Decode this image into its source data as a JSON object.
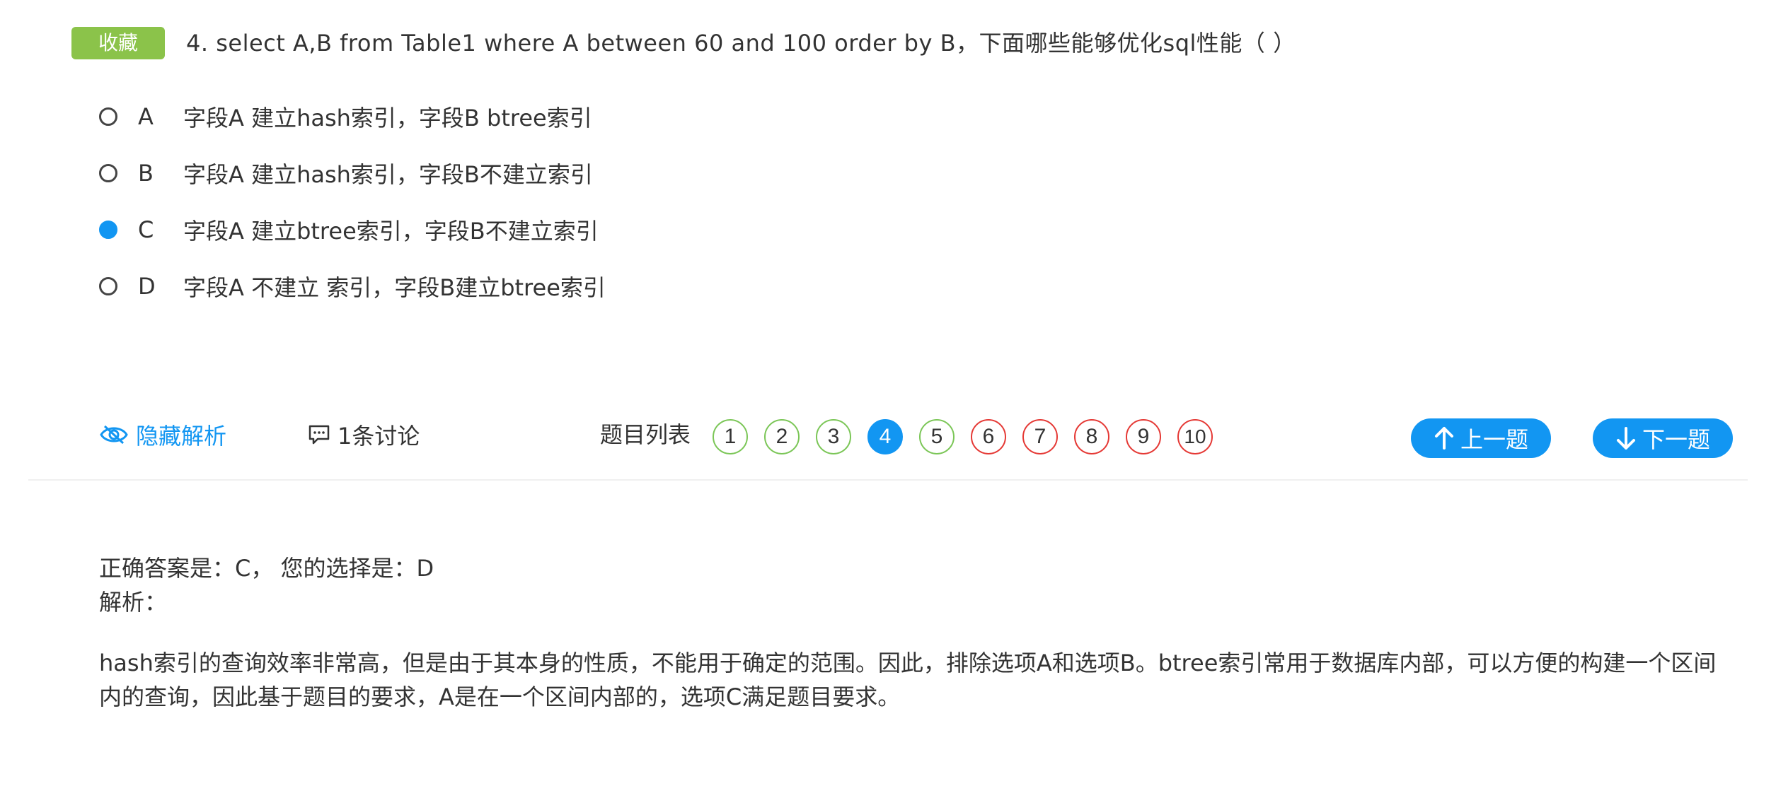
{
  "question": {
    "favorite_label": "收藏",
    "text": "4. select A,B from Table1 where A between 60 and 100 order by B，下面哪些能够优化sql性能（ ）"
  },
  "options": [
    {
      "letter": "A",
      "text": "字段A 建立hash索引，字段B btree索引",
      "selected": false
    },
    {
      "letter": "B",
      "text": "字段A 建立hash索引，字段B不建立索引",
      "selected": false
    },
    {
      "letter": "C",
      "text": "字段A 建立btree索引，字段B不建立索引",
      "selected": true
    },
    {
      "letter": "D",
      "text": "字段A 不建立 索引，字段B建立btree索引",
      "selected": false
    }
  ],
  "toolbar": {
    "hide_analysis_label": "隐藏解析",
    "discussion_label": "1条讨论",
    "question_list_label": "题目列表",
    "question_numbers": [
      {
        "num": "1",
        "status": "correct"
      },
      {
        "num": "2",
        "status": "correct"
      },
      {
        "num": "3",
        "status": "correct"
      },
      {
        "num": "4",
        "status": "current"
      },
      {
        "num": "5",
        "status": "correct"
      },
      {
        "num": "6",
        "status": "wrong"
      },
      {
        "num": "7",
        "status": "wrong"
      },
      {
        "num": "8",
        "status": "wrong"
      },
      {
        "num": "9",
        "status": "wrong"
      },
      {
        "num": "10",
        "status": "wrong"
      }
    ],
    "prev_label": "上一题",
    "next_label": "下一题"
  },
  "answer": {
    "summary": "正确答案是：C，  您的选择是：D",
    "analysis_label": "解析：",
    "analysis_text": "hash索引的查询效率非常高，但是由于其本身的性质，不能用于确定的范围。因此，排除选项A和选项B。btree索引常用于数据库内部，可以方便的构建一个区间内的查询，因此基于题目的要求，A是在一个区间内部的，选项C满足题目要求。"
  },
  "colors": {
    "accent": "#1296f2",
    "favorite": "#8bc34a",
    "correct": "#7bc657",
    "wrong": "#e53935"
  }
}
